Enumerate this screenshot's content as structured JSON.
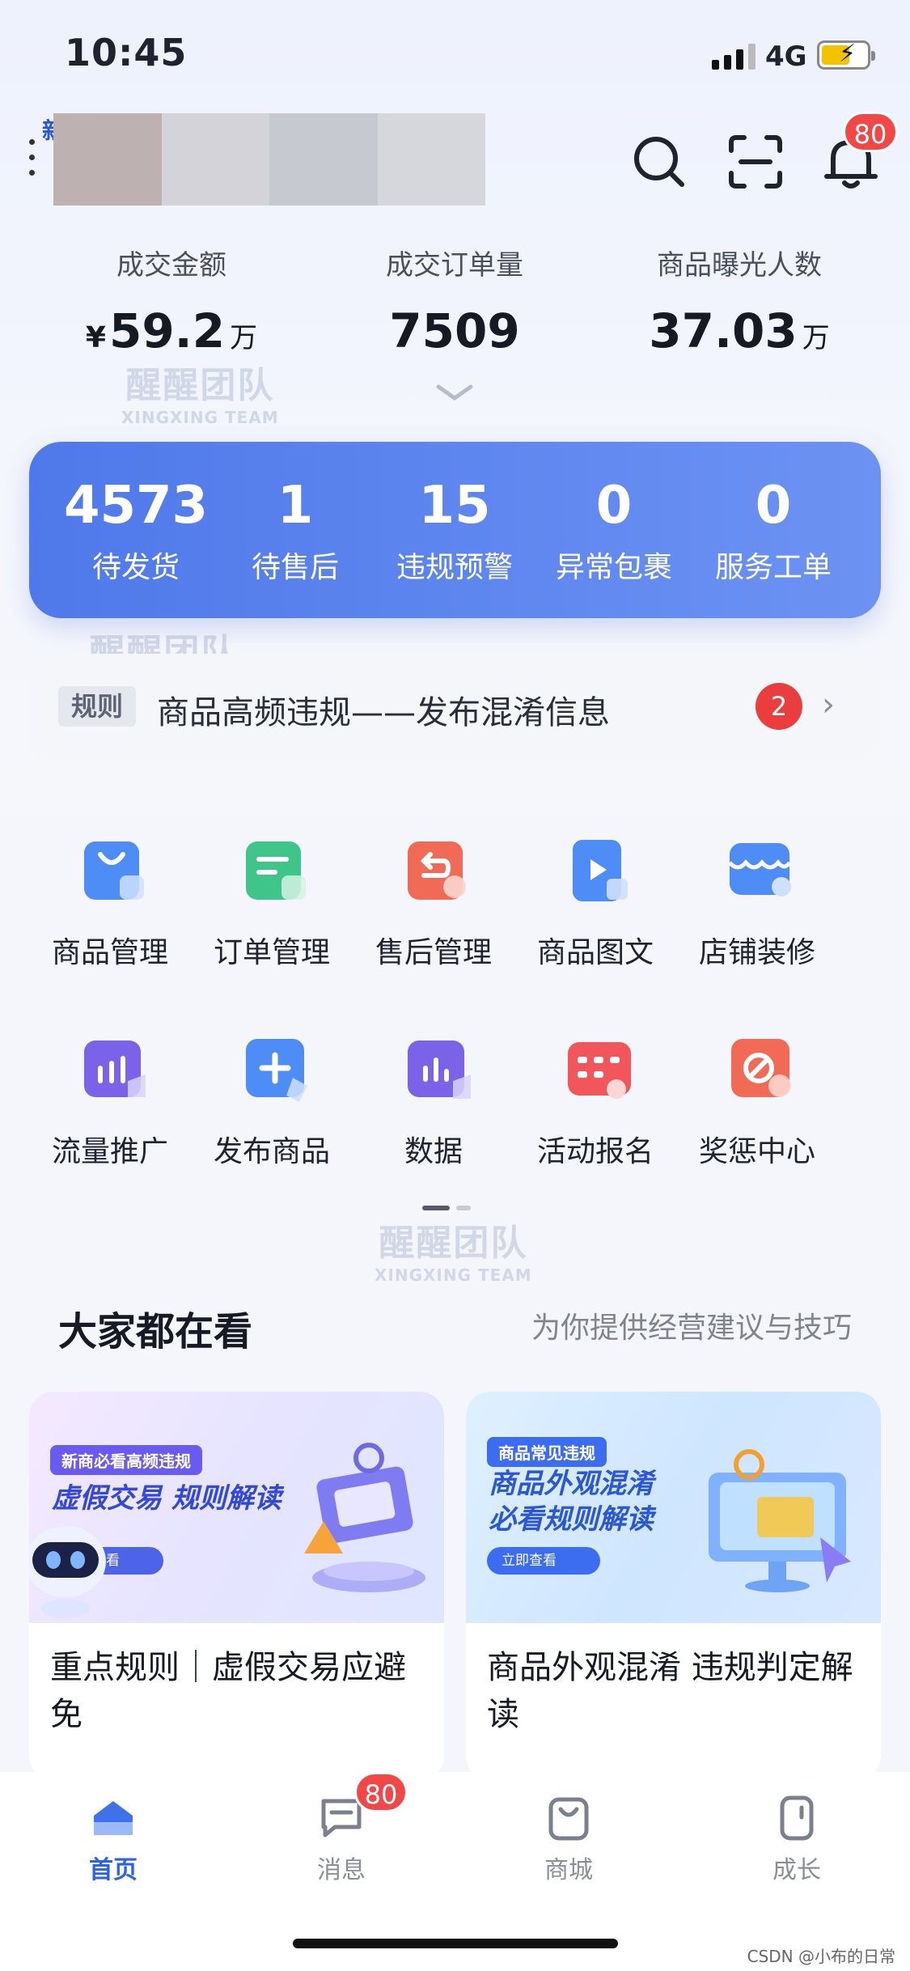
{
  "status_bar": {
    "time": "10:45",
    "network": "4G"
  },
  "header": {
    "store_initial": "新",
    "bell_badge": "80"
  },
  "stats": [
    {
      "label": "成交金额",
      "currency": "¥",
      "value": "59.2",
      "unit": "万"
    },
    {
      "label": "成交订单量",
      "currency": "",
      "value": "7509",
      "unit": ""
    },
    {
      "label": "商品曝光人数",
      "currency": "",
      "value": "37.03",
      "unit": "万"
    }
  ],
  "watermark": {
    "title": "醒醒团队",
    "subtitle": "XINGXING TEAM"
  },
  "todo": [
    {
      "count": "4573",
      "label": "待发货"
    },
    {
      "count": "1",
      "label": "待售后"
    },
    {
      "count": "15",
      "label": "违规预警"
    },
    {
      "count": "0",
      "label": "异常包裹"
    },
    {
      "count": "0",
      "label": "服务工单"
    }
  ],
  "notice": {
    "tag": "规则",
    "text": "商品高频违规——发布混淆信息",
    "badge": "2"
  },
  "tools": [
    {
      "label": "商品管理",
      "icon": "bag-icon",
      "color": "#4d8df5"
    },
    {
      "label": "订单管理",
      "icon": "order-icon",
      "color": "#3fc48a"
    },
    {
      "label": "售后管理",
      "icon": "return-icon",
      "color": "#f06a55"
    },
    {
      "label": "商品图文",
      "icon": "video-icon",
      "color": "#4d8df5"
    },
    {
      "label": "店铺装修",
      "icon": "shop-icon",
      "color": "#4d8df5"
    },
    {
      "label": "流量推广",
      "icon": "traffic-icon",
      "color": "#7a63e8"
    },
    {
      "label": "发布商品",
      "icon": "plus-icon",
      "color": "#4d8df5"
    },
    {
      "label": "数据",
      "icon": "chart-icon",
      "color": "#7a63e8"
    },
    {
      "label": "活动报名",
      "icon": "calendar-icon",
      "color": "#f0565a"
    },
    {
      "label": "奖惩中心",
      "icon": "ban-icon",
      "color": "#f06a55"
    }
  ],
  "feed_section": {
    "title": "大家都在看",
    "subtitle": "为你提供经营建议与技巧"
  },
  "feed": [
    {
      "pill": "新商必看高频违规",
      "headline1": "虚假交易 规则解读",
      "headline2": "",
      "button": "立即查看",
      "title": "重点规则｜虚假交易应避免"
    },
    {
      "pill": "商品常见违规",
      "headline1": "商品外观混淆",
      "headline2": "必看规则解读",
      "button": "立即查看",
      "title": "商品外观混淆 违规判定解读"
    }
  ],
  "tabbar": [
    {
      "label": "首页",
      "icon": "home-icon",
      "active": true
    },
    {
      "label": "消息",
      "icon": "message-icon",
      "active": false
    },
    {
      "label": "商城",
      "icon": "mall-icon",
      "active": false
    },
    {
      "label": "成长",
      "icon": "growth-icon",
      "active": false
    }
  ],
  "tab_badge": "80",
  "credit": "CSDN @小布的日常",
  "colors": {
    "accent": "#4f79ea",
    "badge": "#f34747",
    "active_tab": "#2b63e6"
  }
}
